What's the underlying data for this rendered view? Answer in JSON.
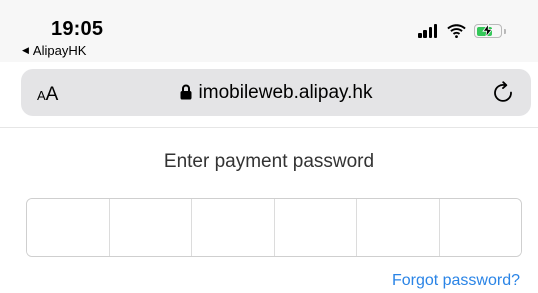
{
  "status_bar": {
    "time": "19:05",
    "back_app": "AlipayHK",
    "battery_color": "#34c759"
  },
  "browser": {
    "aa_label_small": "A",
    "aa_label_large": "A",
    "url": "imobileweb.alipay.hk",
    "lock_icon": "lock-icon",
    "reload_icon": "reload-icon"
  },
  "page": {
    "title": "Enter payment password",
    "pin_cells": [
      "",
      "",
      "",
      "",
      "",
      ""
    ],
    "forgot_link": "Forgot password?",
    "link_color": "#2a84e6"
  }
}
